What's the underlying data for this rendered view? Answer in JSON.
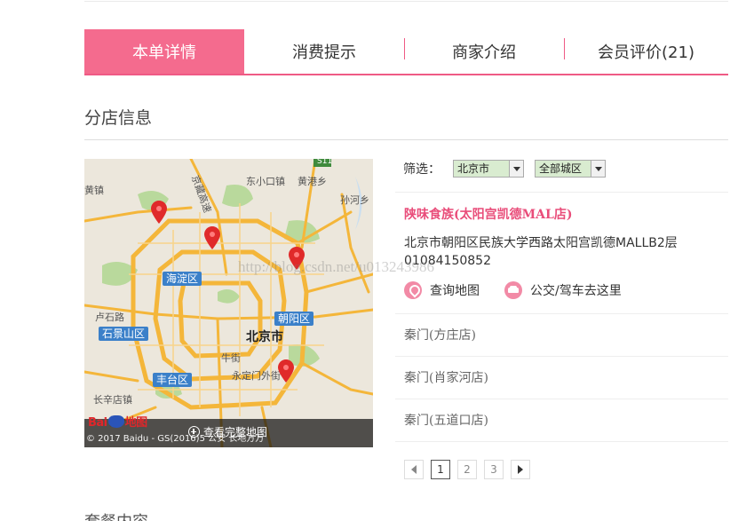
{
  "tabs": [
    {
      "label": "本单详情",
      "active": true
    },
    {
      "label": "消费提示",
      "active": false
    },
    {
      "label": "商家介绍",
      "active": false
    },
    {
      "label": "会员评价(21)",
      "active": false
    }
  ],
  "section_title": "分店信息",
  "map": {
    "place_labels": [
      "东小口镇",
      "黄港乡",
      "孙河乡",
      "京藏高速",
      "北京市",
      "牛街",
      "永定门外街",
      "长辛店镇",
      "卢石路",
      "黄镇",
      "S11"
    ],
    "districts": [
      "海淀区",
      "朝阳区",
      "石景山区",
      "丰台区"
    ],
    "logo_text": "地图",
    "copyright": "© 2017 Baidu - GS(2016)5 公安 长地方万",
    "view_full_label": "查看完整地图"
  },
  "filter": {
    "label": "筛选：",
    "city": "北京市",
    "district": "全部城区"
  },
  "store": {
    "name": "陕味食族(太阳宫凯德MAL店)",
    "address": "北京市朝阳区民族大学西路太阳宫凯德MALLB2层",
    "phone": "01084150852",
    "map_link": "查询地图",
    "route_link": "公交/驾车去这里"
  },
  "branches": [
    "秦门(方庄店)",
    "秦门(肖家河店)",
    "秦门(五道口店)"
  ],
  "pagination": {
    "pages": [
      "1",
      "2",
      "3"
    ],
    "current": "1"
  },
  "next_section": "套餐内容",
  "watermark": "http://blog.csdn.net/u013243986",
  "colors": {
    "accent": "#f46b8e",
    "link": "#e94d7a",
    "district_badge": "#3b80c9"
  }
}
